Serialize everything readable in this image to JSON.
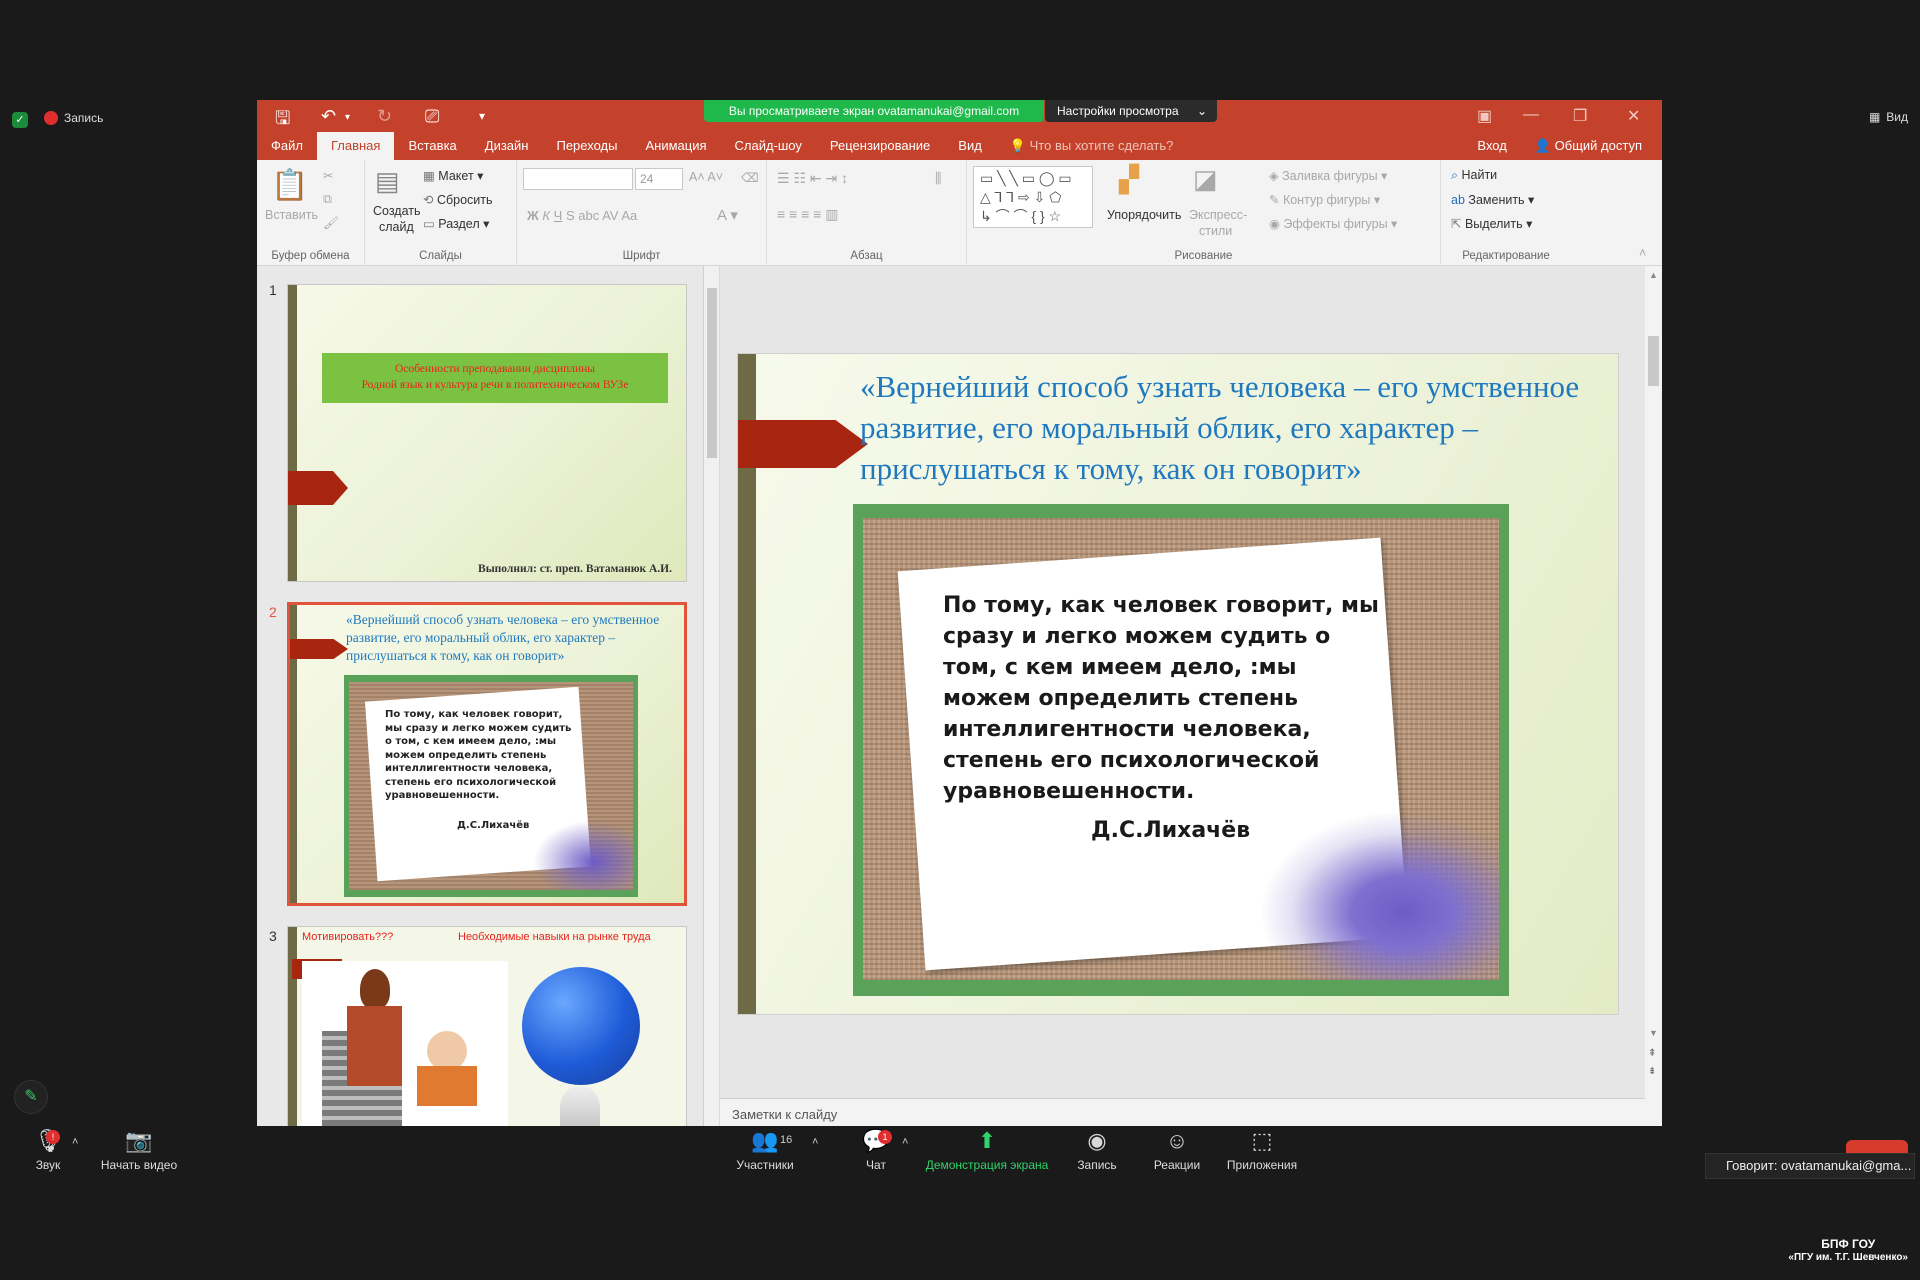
{
  "zoom": {
    "recording_label": "Запись",
    "view_label": "Вид",
    "share_banner": "Вы просматриваете экран ovatamanukai@gmail.com",
    "view_options": "Настройки просмотра",
    "bottom": {
      "audio": "Звук",
      "video": "Начать видео",
      "participants": "Участники",
      "participants_count": "16",
      "chat": "Чат",
      "chat_badge": "1",
      "share": "Демонстрация экрана",
      "record": "Запись",
      "reactions": "Реакции",
      "apps": "Приложения"
    },
    "speaker": "Говорит: ovatamanukai@gma...",
    "org_line1": "БПФ ГОУ",
    "org_line2": "«ПГУ им. Т.Г. Шевченко»"
  },
  "ppt": {
    "menu": [
      "Файл",
      "Главная",
      "Вставка",
      "Дизайн",
      "Переходы",
      "Анимация",
      "Слайд-шоу",
      "Рецензирование",
      "Вид"
    ],
    "tell_me": "Что вы хотите сделать?",
    "login": "Вход",
    "share": "Общий доступ",
    "ribbon": {
      "paste": "Вставить",
      "clipboard": "Буфер обмена",
      "new_slide_1": "Создать",
      "new_slide_2": "слайд",
      "layout": "Макет",
      "reset": "Сбросить",
      "section": "Раздел",
      "slides": "Слайды",
      "font_size": "24",
      "font": "Шрифт",
      "paragraph": "Абзац",
      "arrange": "Упорядочить",
      "quick_styles_1": "Экспресс-",
      "quick_styles_2": "стили",
      "shape_fill": "Заливка фигуры",
      "shape_outline": "Контур фигуры",
      "shape_effects": "Эффекты фигуры",
      "drawing": "Рисование",
      "find": "Найти",
      "replace": "Заменить",
      "select": "Выделить",
      "editing": "Редактирование"
    },
    "notes_placeholder": "Заметки к слайду"
  },
  "thumbnails": {
    "slide1": {
      "num": "1",
      "title_line1": "Особенности преподавании дисциплины",
      "title_line2": "Родной язык и культура речи в политехническом ВУЗе",
      "author": "Выполнил: ст. преп. Ватаманюк А.И."
    },
    "slide2": {
      "num": "2",
      "title": "«Вернейший способ узнать человека – его умственное развитие, его моральный облик, его характер – прислушаться к тому, как он говорит»",
      "quote": "По тому, как человек говорит, мы сразу и легко можем судить о том, с кем имеем дело, :мы можем определить степень интеллигентности человека, степень его психологической уравновешенности.",
      "author": "Д.С.Лихачёв"
    },
    "slide3": {
      "num": "3",
      "left_text": "Мотивировать???",
      "right_text": "Необходимые навыки на рынке труда"
    }
  },
  "slide": {
    "title": "«Вернейший способ узнать человека – его умственное развитие, его моральный облик, его характер – прислушаться к тому, как он говорит»",
    "quote": "По тому, как человек говорит, мы сразу и легко можем судить о том, с кем имеем дело, :мы можем определить степень интеллигентности человека, степень его психологической уравновешенности.",
    "author": "Д.С.Лихачёв"
  },
  "colors": {
    "ppt_accent": "#c4422b",
    "zoom_green": "#1fb84a",
    "slide_title_blue": "#1f79bf",
    "slide_frame_green": "#5aa25a",
    "thumb_title_red": "#e8231a",
    "thumb_title_box": "#7cc242"
  }
}
